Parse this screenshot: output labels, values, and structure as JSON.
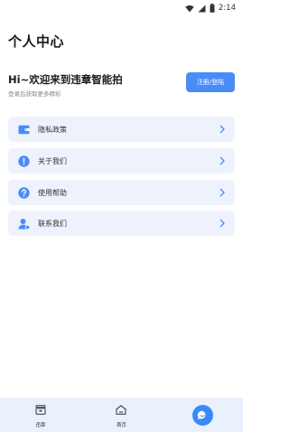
{
  "status_bar": {
    "time": "2:14"
  },
  "header": {
    "title": "个人中心"
  },
  "welcome": {
    "title": "Hi~欢迎来到违章智能拍",
    "subtitle": "登录后获取更多精彩",
    "login_label": "注册/登陆"
  },
  "menu": [
    {
      "label": "隐私政策",
      "icon": "wallet-icon"
    },
    {
      "label": "关于我们",
      "icon": "exclamation-icon"
    },
    {
      "label": "使用帮助",
      "icon": "question-icon"
    },
    {
      "label": "联系我们",
      "icon": "contact-person-icon"
    }
  ],
  "tab_bar": {
    "tabs": [
      {
        "label": "违章",
        "icon": "violation-icon"
      },
      {
        "label": "首页",
        "icon": "home-icon"
      }
    ],
    "fab_icon": "chat-bubble-icon"
  },
  "colors": {
    "accent": "#4a8cf7",
    "card_bg": "#edf2fd",
    "tab_bg": "#eaf1fc",
    "fab": "#3a8af7"
  }
}
